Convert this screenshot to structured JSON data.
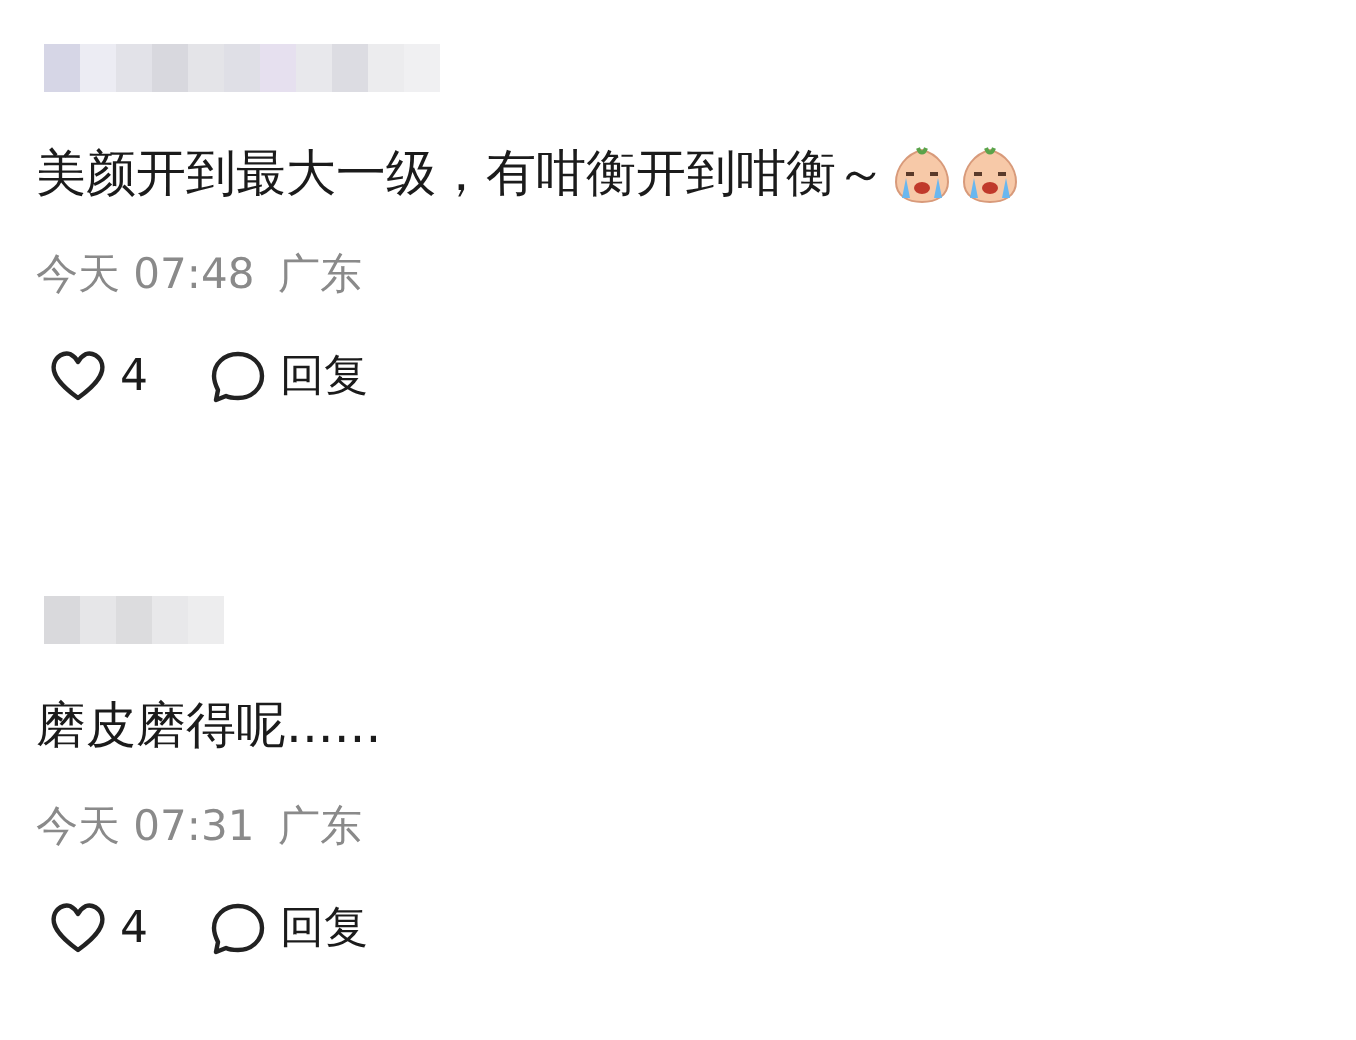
{
  "comments": [
    {
      "text": "美颜开到最大一级，有咁衡开到咁衡～",
      "trailing_icons": [
        {
          "kind": "crying-face"
        },
        {
          "kind": "crying-face"
        }
      ],
      "time": "今天 07:48",
      "location": "广东",
      "likes": "4",
      "reply": "回复"
    },
    {
      "text": "磨皮磨得呢......",
      "time": "今天 07:31",
      "location": "广东",
      "likes": "4",
      "reply": "回复"
    }
  ]
}
